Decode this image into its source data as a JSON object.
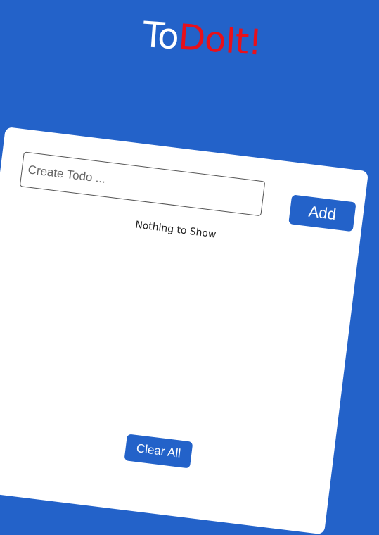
{
  "header": {
    "title_part1": "To",
    "title_part2": "DoIt!"
  },
  "form": {
    "placeholder": "Create Todo ...",
    "value": "",
    "add_label": "Add"
  },
  "list": {
    "empty_text": "Nothing to Show",
    "items": []
  },
  "footer": {
    "clear_label": "Clear All"
  },
  "colors": {
    "background": "#2362c9",
    "accent": "#e8101b",
    "button": "#2362c9",
    "card": "#ffffff"
  }
}
